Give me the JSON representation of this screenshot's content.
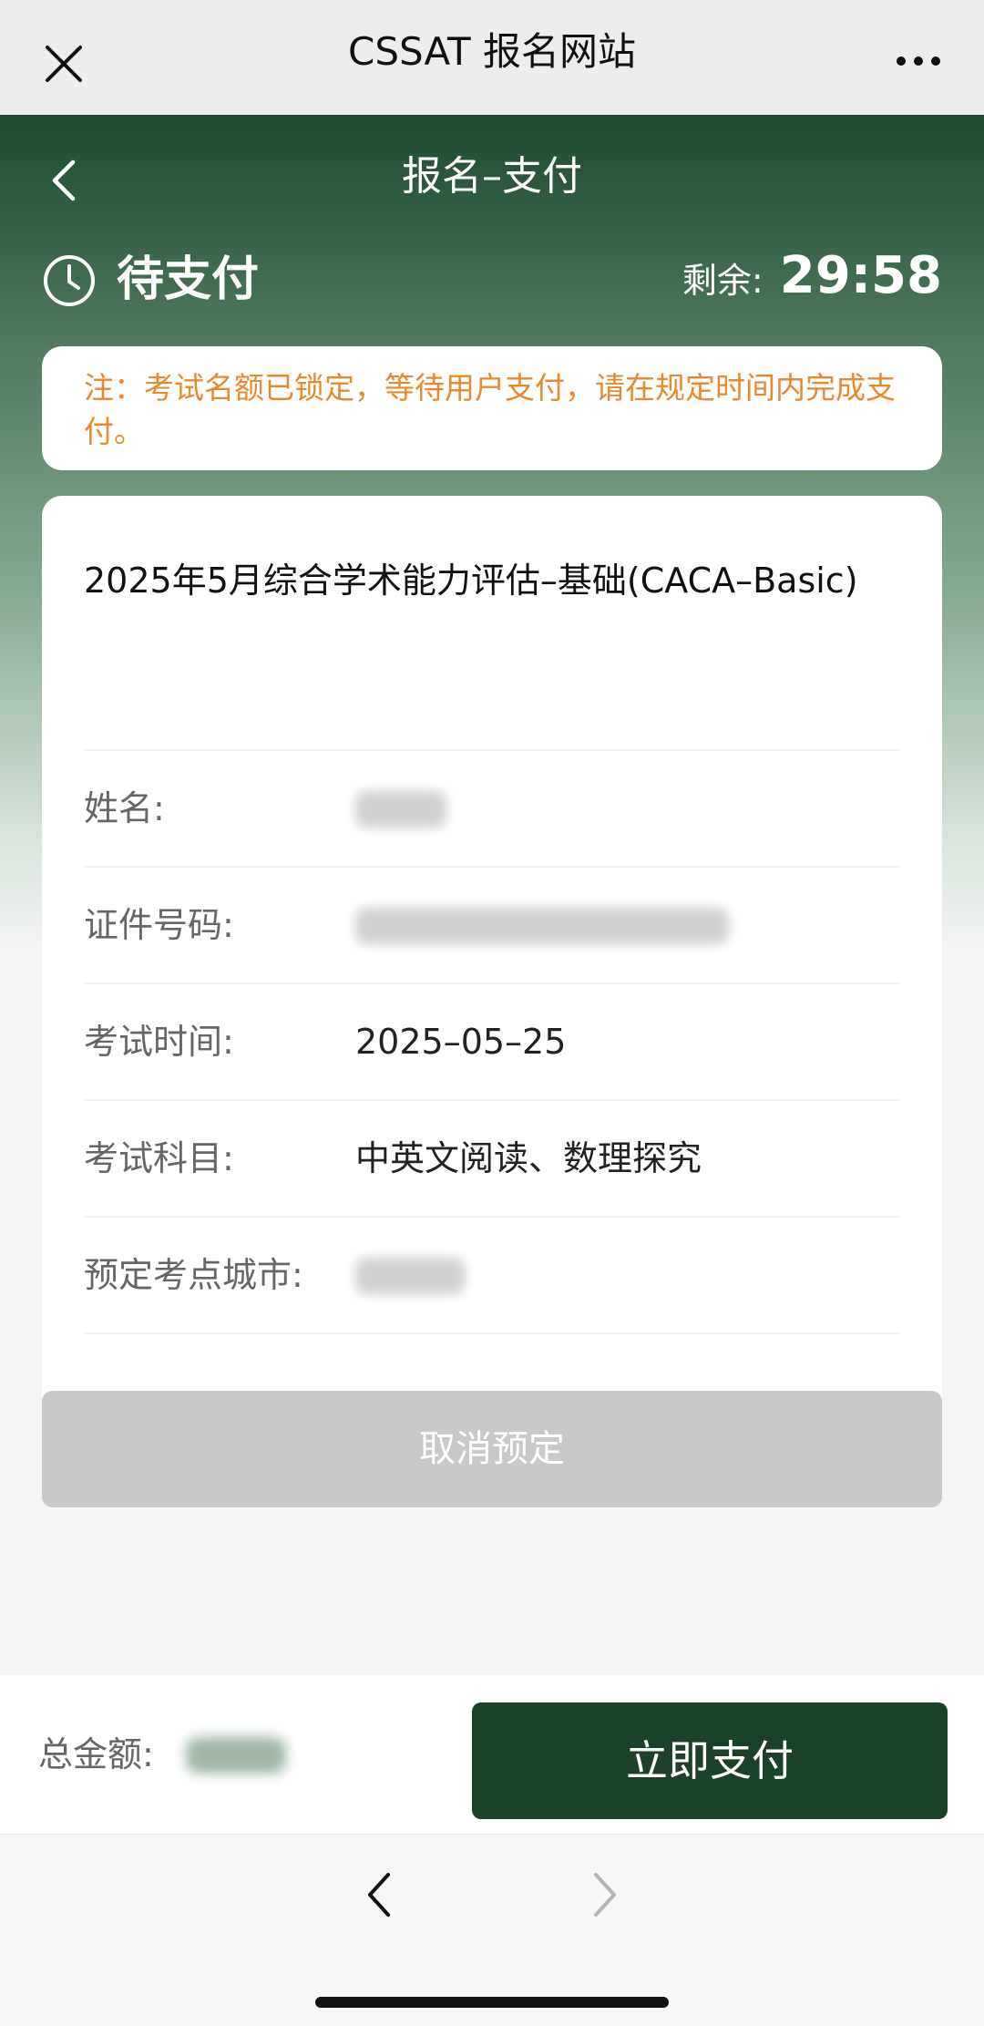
{
  "window": {
    "title": "CSSAT 报名网站"
  },
  "nav": {
    "title": "报名–支付"
  },
  "status": {
    "text": "待支付",
    "remaining_label": "剩余:",
    "remaining_time": "29:58"
  },
  "notice": {
    "text": "注：考试名额已锁定，等待用户支付，请在规定时间内完成支付。"
  },
  "card": {
    "course_title": "2025年5月综合学术能力评估–基础(CACA–Basic)",
    "rows": [
      {
        "label": "姓名:",
        "value": ""
      },
      {
        "label": "证件号码:",
        "value": ""
      },
      {
        "label": "考试时间:",
        "value": "2025–05–25"
      },
      {
        "label": "考试科目:",
        "value": "中英文阅读、数理探究"
      },
      {
        "label": "预定考点城市:",
        "value": ""
      }
    ]
  },
  "buttons": {
    "cancel": "取消预定",
    "pay": "立即支付"
  },
  "total": {
    "label": "总金额:"
  },
  "colors": {
    "primary": "#1b4129",
    "notice": "#e58a2e",
    "disabled": "#c9c9c9"
  }
}
